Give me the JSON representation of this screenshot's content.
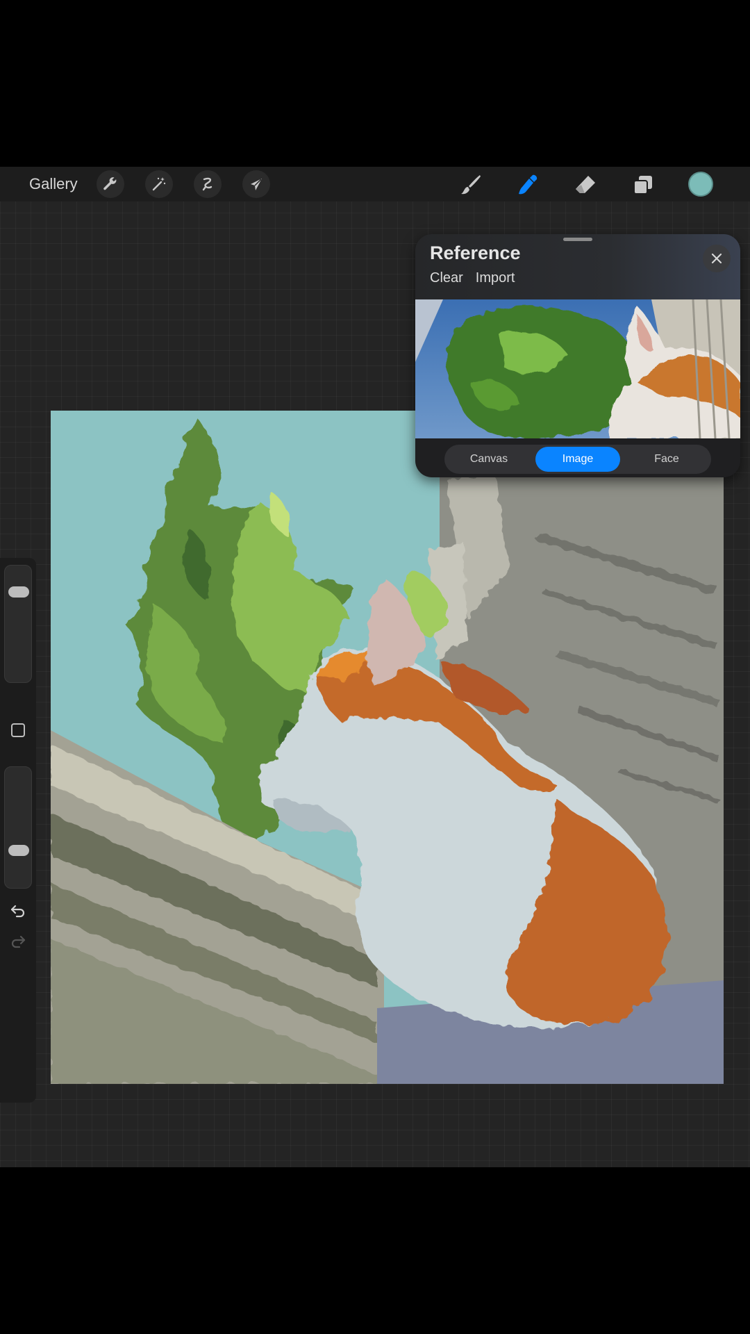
{
  "toolbar": {
    "gallery_label": "Gallery",
    "left_tools": [
      {
        "icon": "wrench-icon",
        "name": "actions"
      },
      {
        "icon": "magic-wand-icon",
        "name": "adjustments"
      },
      {
        "icon": "selection-icon",
        "name": "selection"
      },
      {
        "icon": "arrow-cursor-icon",
        "name": "transform"
      }
    ],
    "right_tools": [
      {
        "icon": "brush-icon",
        "name": "paint"
      },
      {
        "icon": "smudge-icon",
        "name": "smudge",
        "active": true
      },
      {
        "icon": "eraser-icon",
        "name": "erase"
      },
      {
        "icon": "layers-icon",
        "name": "layers"
      }
    ],
    "active_color": "#7cbcb8",
    "active_tool_color": "#0a84ff"
  },
  "sidebar": {
    "size_slider_icon": "size-slider",
    "opacity_slider_icon": "opacity-slider",
    "modify_icon": "square-icon",
    "undo_icon": "undo-icon",
    "redo_icon": "redo-icon"
  },
  "reference": {
    "title": "Reference",
    "clear_label": "Clear",
    "import_label": "Import",
    "tabs": [
      "Canvas",
      "Image",
      "Face"
    ],
    "active_tab": "Image"
  }
}
